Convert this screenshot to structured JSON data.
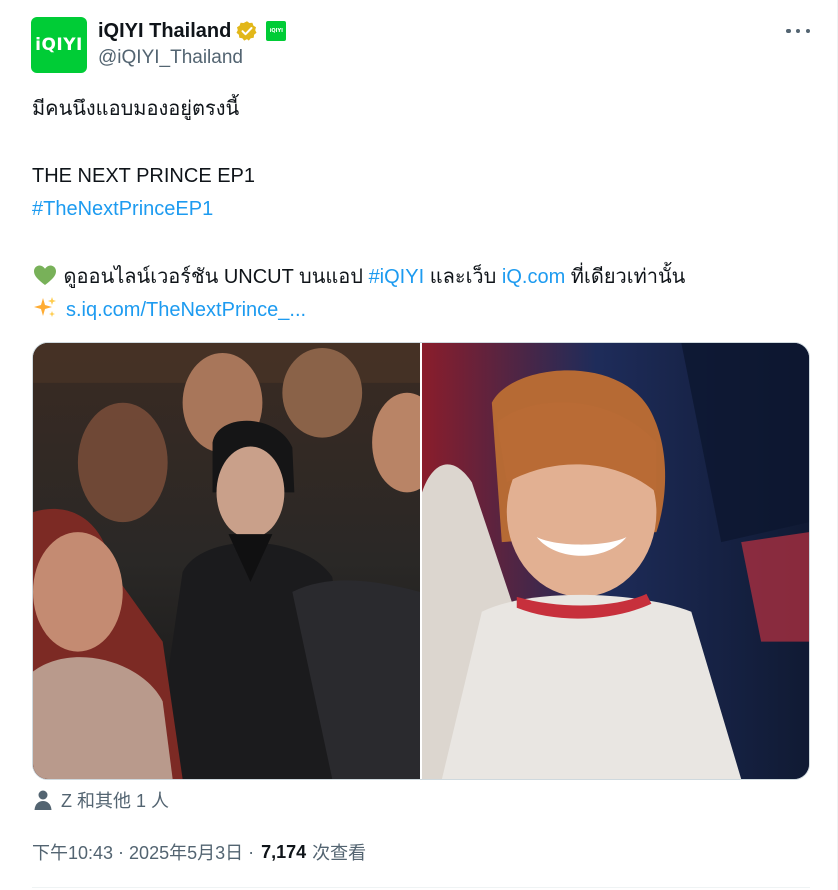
{
  "account": {
    "display_name": "iQIYI Thailand",
    "handle": "@iQIYI_Thailand",
    "avatar_text": "iQIYI",
    "affiliate_badge_text": "iQIYI",
    "verified": true,
    "brand_color": "#00cc36",
    "verified_color": "#e2b719"
  },
  "tweet": {
    "line1": "มีคนนึงแอบมองอยู่ตรงนี้",
    "line2": "THE NEXT PRINCE EP1",
    "hashtag1": "#TheNextPrinceEP1",
    "line3_emoji": "green-heart",
    "line3_text1": " ดูออนไลน์เวอร์ชัน UNCUT บนแอป ",
    "line3_hashtag": "#iQIYI",
    "line3_text2": " และเว็บ ",
    "line3_link": "iQ.com",
    "line3_text3": " ที่เดียวเท่านั้น",
    "line4_emoji": "sparkles",
    "line4_link": "s.iq.com/TheNextPrince_..."
  },
  "media": {
    "photo_left": "crowd-photo",
    "photo_right": "smiling-man-photo"
  },
  "tagged": {
    "icon": "person-icon",
    "text": "Z 和其他 1 人"
  },
  "meta": {
    "time": "下午10:43",
    "separator1": "·",
    "date": "2025年5月3日",
    "separator2": "·",
    "views_count": "7,174",
    "views_label": "次查看"
  },
  "colors": {
    "link": "#1d9bf0",
    "secondary_text": "#536471"
  }
}
